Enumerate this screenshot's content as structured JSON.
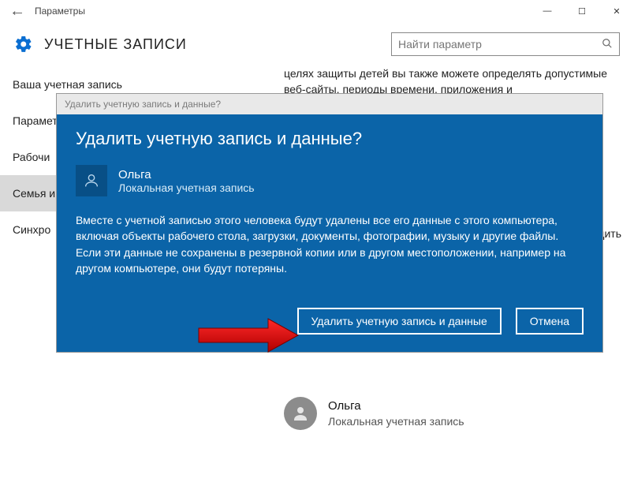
{
  "window": {
    "title": "Параметры"
  },
  "header": {
    "title": "УЧЕТНЫЕ ЗАПИСИ",
    "search_placeholder": "Найти параметр"
  },
  "sidebar": {
    "items": [
      {
        "label": "Ваша учетная запись"
      },
      {
        "label": "Параметры"
      },
      {
        "label": "Рабочи"
      },
      {
        "label": "Семья и"
      },
      {
        "label": "Синхро"
      }
    ]
  },
  "content": {
    "blurb": "целях защиты детей вы также можете определять допустимые веб-сайты, периоды времени, приложения и",
    "edit_fragment": "дить",
    "user": {
      "name": "Ольга",
      "type": "Локальная учетная запись"
    }
  },
  "dialog": {
    "titlebar": "Удалить учетную запись и данные?",
    "heading": "Удалить учетную запись и данные?",
    "account": {
      "name": "Ольга",
      "type": "Локальная учетная запись"
    },
    "description": "Вместе с учетной записью этого человека будут удалены все его данные с этого компьютера, включая объекты рабочего стола, загрузки, документы, фотографии, музыку и другие файлы. Если эти данные не сохранены в резервной копии или в другом местоположении, например на другом компьютере, они будут потеряны.",
    "primary": "Удалить учетную запись и данные",
    "cancel": "Отмена"
  }
}
